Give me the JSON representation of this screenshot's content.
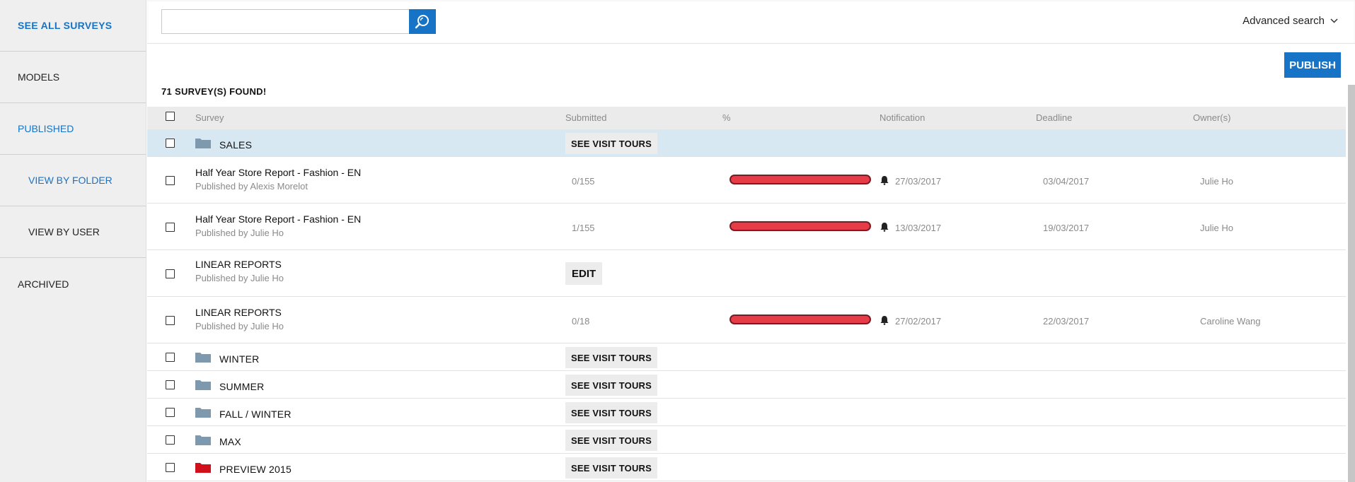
{
  "sidebar": {
    "items": [
      {
        "label": "SEE ALL SURVEYS"
      },
      {
        "label": "MODELS"
      },
      {
        "label": "PUBLISHED"
      },
      {
        "label": "VIEW BY FOLDER"
      },
      {
        "label": "VIEW BY USER"
      },
      {
        "label": "ARCHIVED"
      }
    ]
  },
  "search": {
    "value": "",
    "placeholder": ""
  },
  "advanced_search_label": "Advanced search",
  "publish_label": "PUBLISH",
  "found_text": "71 SURVEY(S) FOUND!",
  "table": {
    "headers": {
      "survey": "Survey",
      "submitted": "Submitted",
      "percent": "%",
      "notification": "Notification",
      "deadline": "Deadline",
      "owners": "Owner(s)"
    },
    "rows": [
      {
        "type": "folder",
        "name": "SALES",
        "action": "SEE VISIT TOURS",
        "folder_color": "#7e98ad",
        "highlight": true
      },
      {
        "type": "survey",
        "title": "Half Year Store Report - Fashion - EN",
        "published_by": "Published by Alexis Morelot",
        "submitted": "0/155",
        "progress": 0,
        "notification": "27/03/2017",
        "deadline": "03/04/2017",
        "owner": "Julie Ho"
      },
      {
        "type": "survey",
        "title": "Half Year Store Report - Fashion - EN",
        "published_by": "Published by Julie Ho",
        "submitted": "1/155",
        "progress": 0.6,
        "notification": "13/03/2017",
        "deadline": "19/03/2017",
        "owner": "Julie Ho"
      },
      {
        "type": "survey-edit",
        "title": "LINEAR REPORTS",
        "published_by": "Published by Julie Ho",
        "action": "EDIT"
      },
      {
        "type": "survey",
        "title": "LINEAR REPORTS",
        "published_by": "Published by Julie Ho",
        "submitted": "0/18",
        "progress": 0,
        "notification": "27/02/2017",
        "deadline": "22/03/2017",
        "owner": "Caroline Wang"
      },
      {
        "type": "folder",
        "name": "WINTER",
        "action": "SEE VISIT TOURS",
        "folder_color": "#7e98ad"
      },
      {
        "type": "folder",
        "name": "SUMMER",
        "action": "SEE VISIT TOURS",
        "folder_color": "#7e98ad"
      },
      {
        "type": "folder",
        "name": "FALL / WINTER",
        "action": "SEE VISIT TOURS",
        "folder_color": "#7e98ad"
      },
      {
        "type": "folder",
        "name": "MAX",
        "action": "SEE VISIT TOURS",
        "folder_color": "#7e98ad"
      },
      {
        "type": "folder",
        "name": "PREVIEW 2015",
        "action": "SEE VISIT TOURS",
        "folder_color": "#d0111b"
      }
    ]
  },
  "colors": {
    "accent": "#1673c6",
    "progress_bar": "#e63c47",
    "highlight_row": "#d8e8f3"
  }
}
